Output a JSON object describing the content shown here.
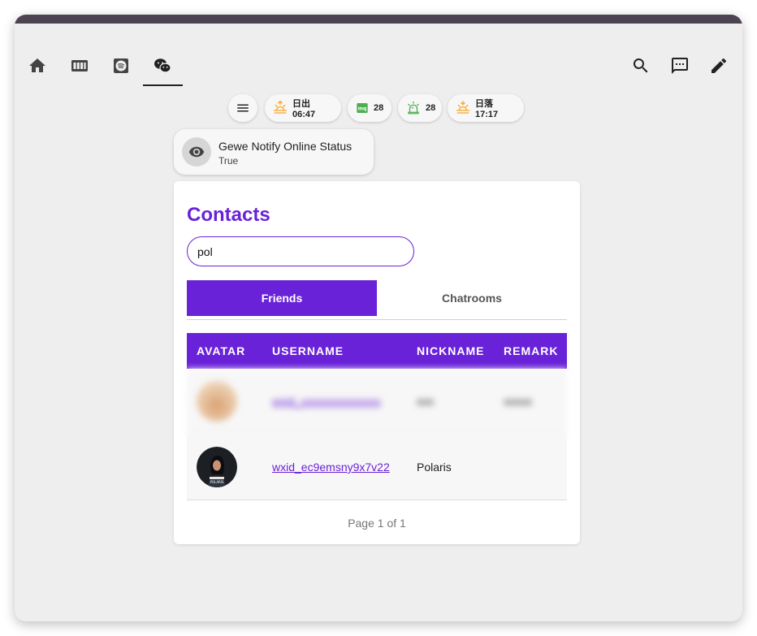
{
  "toolbar": {
    "left_icons": [
      "home-icon",
      "media-grid-icon",
      "spotify-icon",
      "wechat-icon"
    ],
    "right_icons": [
      "search-icon",
      "assist-icon",
      "edit-icon"
    ],
    "active_tab": "wechat-icon"
  },
  "badges": [
    {
      "icon": "sunrise-icon",
      "label": "日出 06:47",
      "color": "#f5a623"
    },
    {
      "icon": "mqtt-icon",
      "label": "28",
      "color": "#4caf50"
    },
    {
      "icon": "alarm-light-icon",
      "label": "28",
      "color": "#4caf50"
    },
    {
      "icon": "sunset-icon",
      "label": "日落 17:17",
      "color": "#f5a623"
    }
  ],
  "status": {
    "name": "Gewe Notify Online Status",
    "value": "True",
    "icon": "eye-icon"
  },
  "contacts": {
    "title": "Contacts",
    "search_value": "pol",
    "tabs": [
      "Friends",
      "Chatrooms"
    ],
    "active_tab": "Friends",
    "columns": [
      "AVATAR",
      "USERNAME",
      "NICKNAME",
      "REMARK"
    ],
    "rows": [
      {
        "username": "wxid_xxxxxxxxxxxxxx",
        "nickname": "xxx",
        "remark": "xxxxx",
        "blurred": true
      },
      {
        "username": "wxid_ec9emsny9x7v22",
        "nickname": "Polaris",
        "remark": "",
        "blurred": false
      }
    ],
    "pagination": "Page 1 of 1"
  },
  "colors": {
    "accent": "#6a22d8",
    "titlebar": "#4e4350",
    "background": "#eeeeee"
  }
}
